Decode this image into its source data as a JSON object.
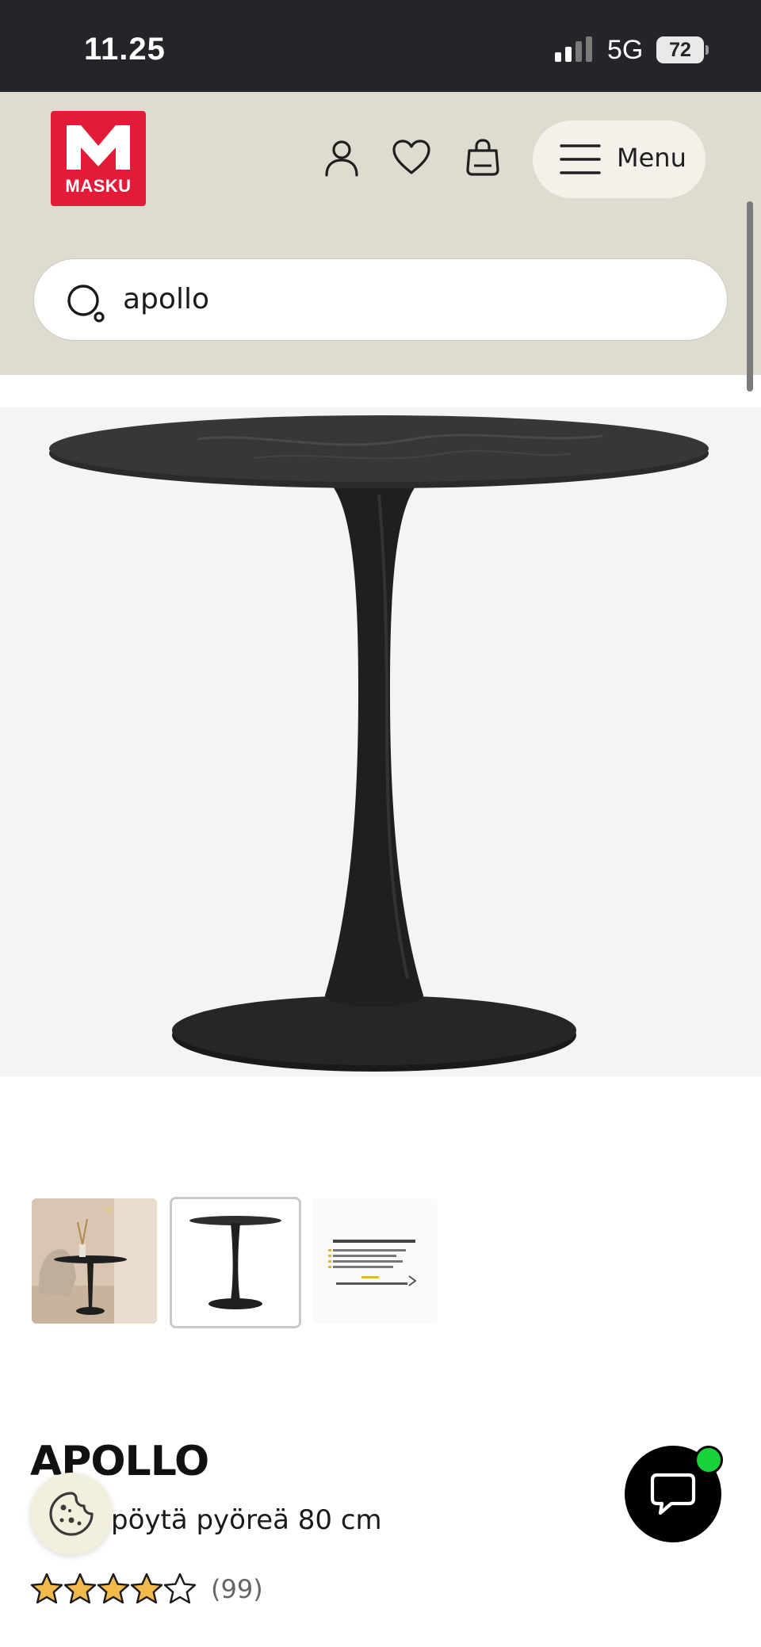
{
  "status_bar": {
    "time": "11.25",
    "network": "5G",
    "battery": "72"
  },
  "header": {
    "logo_text": "MASKU",
    "menu_label": "Menu",
    "icons": [
      "account-icon",
      "heart-icon",
      "bag-icon",
      "hamburger-icon"
    ]
  },
  "search": {
    "value": "apollo"
  },
  "gallery": {
    "thumbnails": [
      "room-scene",
      "table-product",
      "info-card"
    ],
    "selected_index": 1,
    "info_card": {
      "title": "Miksi tyytyväisyys Maskuun on yli 90%?",
      "lines": [
        "98% tuotteista valitaan ilman lisäkuluja",
        "Henkilökunnalla oma ostohuoli",
        "Tuotteet osaavt tarkeet ja sähkövalikoima",
        "Jopa 6 kk koroton maksuaika"
      ],
      "footer": "14000 arvostelun keskiarvo 4,5/5"
    }
  },
  "product": {
    "name": "APOLLO",
    "description": "pöytä pyöreä 80 cm",
    "rating_value": 4,
    "rating_max": 5,
    "review_count": "(99)"
  },
  "colors": {
    "status_bg": "#23252b",
    "header_bg": "#dedbd0",
    "brand_red": "#e31b38",
    "star_fill": "#f2b94b",
    "chat_dot": "#18d43a"
  }
}
